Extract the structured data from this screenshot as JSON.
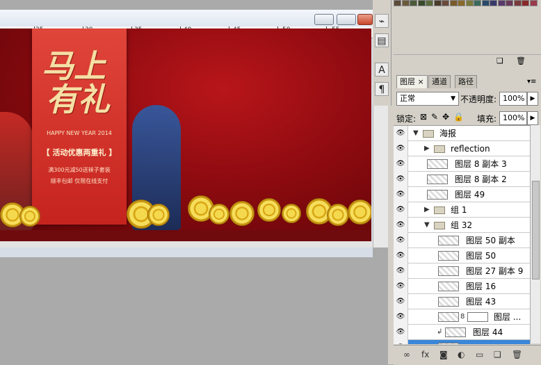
{
  "ruler": {
    "numbers": [
      "25",
      "30",
      "35",
      "40",
      "45",
      "50",
      "55"
    ]
  },
  "banner": {
    "title_line1": "马上",
    "title_line2": "有礼",
    "happy": "HAPPY NEW YEAR 2014",
    "promo": "【 活动优惠两重礼 】",
    "line1": "满300元减50送袜子套装",
    "line2": "顺丰包邮 仅限在线支付"
  },
  "tools": {
    "icons": [
      "brush-icon",
      "stamp-icon",
      "character-icon",
      "paragraph-icon"
    ]
  },
  "layers_panel": {
    "tabs": [
      "图层",
      "通道",
      "路径"
    ],
    "tab_close": "×",
    "blend_mode": "正常",
    "opacity_label": "不透明度:",
    "opacity_value": "100%",
    "lock_label": "锁定:",
    "fill_label": "填充:",
    "fill_value": "100%",
    "layers": [
      {
        "name": "海报",
        "kind": "folder",
        "indent": 0,
        "expanded": true
      },
      {
        "name": "reflection",
        "kind": "folder",
        "indent": 1,
        "expanded": false
      },
      {
        "name": "图层 8 副本 3",
        "kind": "layer",
        "indent": 1
      },
      {
        "name": "图层 8 副本 2",
        "kind": "layer",
        "indent": 1
      },
      {
        "name": "图层 49",
        "kind": "layer",
        "indent": 1
      },
      {
        "name": "组 1",
        "kind": "folder",
        "indent": 1,
        "expanded": false
      },
      {
        "name": "组 32",
        "kind": "folder",
        "indent": 1,
        "expanded": true
      },
      {
        "name": "图层 50 副本",
        "kind": "layer",
        "indent": 2
      },
      {
        "name": "图层 50",
        "kind": "layer",
        "indent": 2
      },
      {
        "name": "图层 27 副本 9",
        "kind": "layer",
        "indent": 2
      },
      {
        "name": "图层 16",
        "kind": "layer",
        "indent": 2
      },
      {
        "name": "图层 43",
        "kind": "layer",
        "indent": 2
      },
      {
        "name": "图层 ...",
        "kind": "masked",
        "indent": 2
      },
      {
        "name": "图层 44",
        "kind": "clipped",
        "indent": 2
      },
      {
        "name": "",
        "kind": "selected",
        "indent": 2
      }
    ],
    "bottom_icons": [
      "link-icon",
      "fx-icon",
      "mask-icon",
      "adjustment-icon",
      "group-icon",
      "new-layer-icon",
      "trash-icon"
    ]
  },
  "colors": {
    "accent_selected": "#3a86d8",
    "banner_red": "#c5241e",
    "gold": "#f4d94e"
  }
}
